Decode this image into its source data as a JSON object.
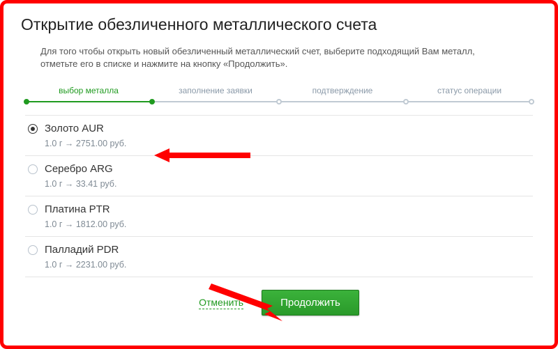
{
  "page": {
    "title": "Открытие обезличенного металлического счета",
    "description": "Для того чтобы открыть новый обезличенный металлический счет, выберите подходящий Вам металл, отметьте его в списке и нажмите на кнопку «Продолжить»."
  },
  "steps": {
    "items": [
      {
        "label": "выбор металла",
        "active": true
      },
      {
        "label": "заполнение заявки",
        "active": false
      },
      {
        "label": "подтверждение",
        "active": false
      },
      {
        "label": "статус операции",
        "active": false
      }
    ]
  },
  "metals": [
    {
      "name": "Золото AUR",
      "rate": "1.0 г → 2751.00 руб.",
      "selected": true
    },
    {
      "name": "Серебро ARG",
      "rate": "1.0 г → 33.41 руб.",
      "selected": false
    },
    {
      "name": "Платина PTR",
      "rate": "1.0 г → 1812.00 руб.",
      "selected": false
    },
    {
      "name": "Палладий PDR",
      "rate": "1.0 г → 2231.00 руб.",
      "selected": false
    }
  ],
  "actions": {
    "cancel": "Отменить",
    "continue": "Продолжить"
  }
}
